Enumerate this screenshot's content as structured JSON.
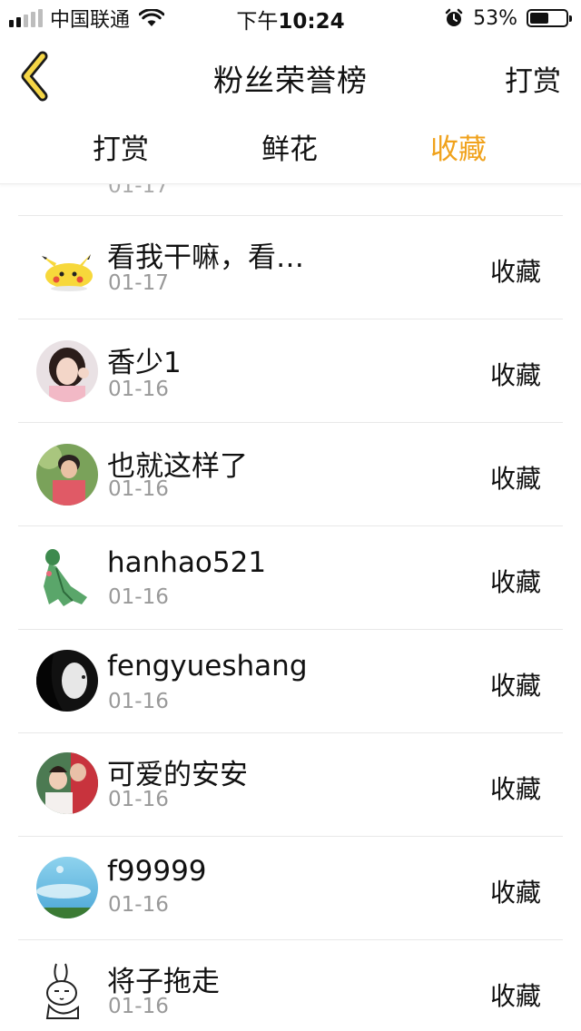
{
  "status_bar": {
    "carrier": "中国联通",
    "time_prefix": "下午",
    "time": "10:24",
    "battery_percent": "53%",
    "battery_level": 0.53,
    "signal_bars_filled": 2,
    "signal_bars_total": 5
  },
  "nav": {
    "back_icon": "chevron-left-icon",
    "title": "粉丝荣誉榜",
    "action_label": "打赏"
  },
  "tabs": [
    {
      "label": "打赏",
      "active": false
    },
    {
      "label": "鲜花",
      "active": false
    },
    {
      "label": "收藏",
      "active": true
    }
  ],
  "colors": {
    "accent": "#f0a21c",
    "back_icon_fill": "#f5d646",
    "date_text": "#999999",
    "divider": "#e8e8e8"
  },
  "list": {
    "partial_first_date": "01-17",
    "items": [
      {
        "name": "看我干嘛，看…",
        "date": "01-17",
        "action": "收藏",
        "avatar": "pikachu-avatar"
      },
      {
        "name": "香少1",
        "date": "01-16",
        "action": "收藏",
        "avatar": "girl-photo-avatar"
      },
      {
        "name": "也就这样了",
        "date": "01-16",
        "action": "收藏",
        "avatar": "boy-photo-avatar"
      },
      {
        "name": "hanhao521",
        "date": "01-16",
        "action": "收藏",
        "avatar": "green-figure-avatar"
      },
      {
        "name": "fengyueshang",
        "date": "01-16",
        "action": "收藏",
        "avatar": "bw-portrait-avatar"
      },
      {
        "name": "可爱的安安",
        "date": "01-16",
        "action": "收藏",
        "avatar": "couple-photo-avatar"
      },
      {
        "name": "f99999",
        "date": "01-16",
        "action": "收藏",
        "avatar": "sky-landscape-avatar"
      },
      {
        "name": "将子拖走",
        "date": "01-16",
        "action": "收藏",
        "avatar": "rabbit-sketch-avatar"
      }
    ]
  }
}
